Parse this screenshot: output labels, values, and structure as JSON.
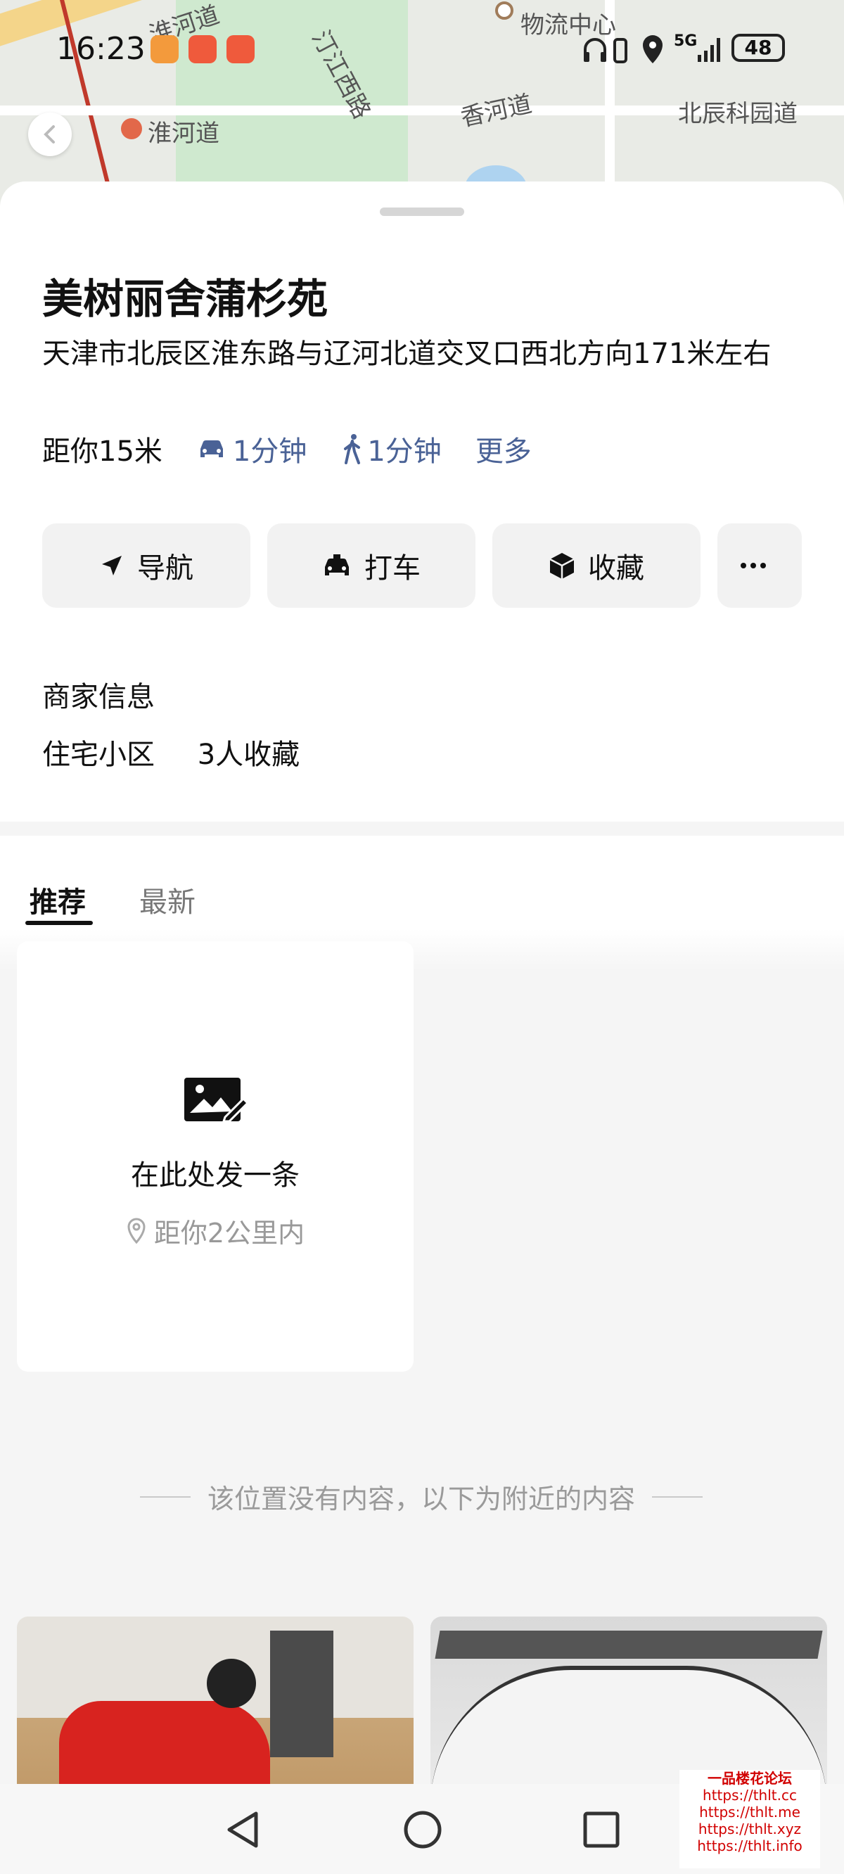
{
  "status_bar": {
    "time": "16:23",
    "network": "5G",
    "battery": "48"
  },
  "map": {
    "labels": [
      "淮河道",
      "淮河道",
      "汀江西路",
      "香河道",
      "北辰科园道",
      "物流中心"
    ]
  },
  "place": {
    "title": "美树丽舍蒲杉苑",
    "address": "天津市北辰区淮东路与辽河北道交叉口西北方向171米左右",
    "distance": "距你15米",
    "drive_time": "1分钟",
    "walk_time": "1分钟",
    "more": "更多"
  },
  "actions": {
    "navigate": "导航",
    "taxi": "打车",
    "favorite": "收藏",
    "more_icon": "more-icon"
  },
  "merchant": {
    "title": "商家信息",
    "type": "住宅小区",
    "favorites": "3人收藏"
  },
  "tabs": {
    "recommend": "推荐",
    "latest": "最新"
  },
  "post_prompt": {
    "title": "在此处发一条",
    "range": "距你2公里内"
  },
  "nearby_divider": "该位置没有内容，以下为附近的内容",
  "watermark": {
    "lines": [
      "一品楼花论坛",
      "https://thlt.cc",
      "https://thlt.me",
      "https://thlt.xyz",
      "https://thlt.info"
    ]
  },
  "colors": {
    "accent_blue": "#4a6296",
    "app_orange": "#f39a3c"
  }
}
